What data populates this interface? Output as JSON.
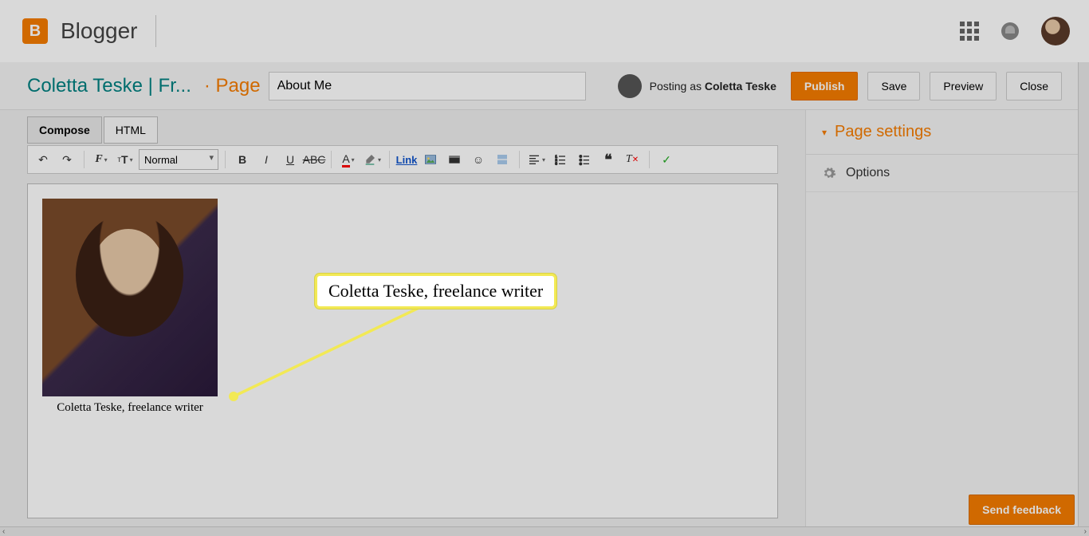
{
  "header": {
    "product": "Blogger"
  },
  "subheader": {
    "blog_title": "Coletta Teske | Fr...",
    "section": "Page",
    "title_value": "About Me",
    "posting_as_prefix": "Posting as ",
    "posting_as_name": "Coletta Teske",
    "publish": "Publish",
    "save": "Save",
    "preview": "Preview",
    "close": "Close"
  },
  "tabs": {
    "compose": "Compose",
    "html": "HTML"
  },
  "toolbar": {
    "format_select": "Normal",
    "link": "Link"
  },
  "content": {
    "caption": "Coletta Teske, freelance writer",
    "callout": "Coletta Teske, freelance writer"
  },
  "sidebar": {
    "title": "Page settings",
    "options": "Options"
  },
  "feedback": "Send feedback"
}
